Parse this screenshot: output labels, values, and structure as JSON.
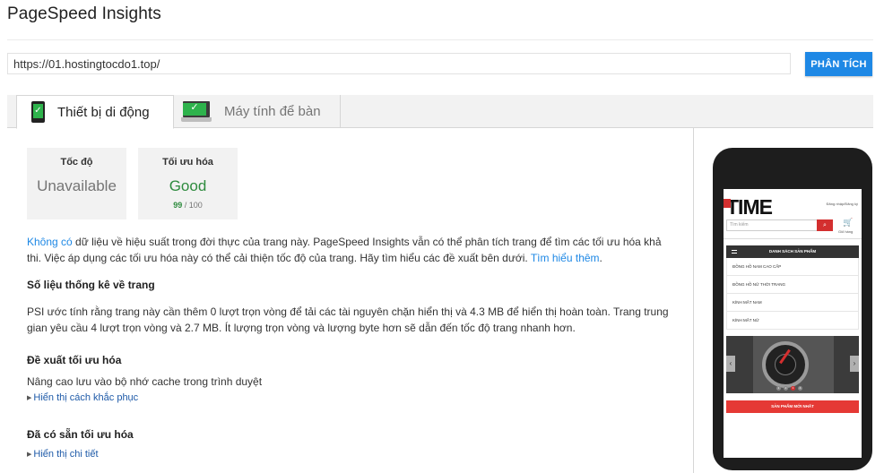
{
  "app": {
    "title": "PageSpeed Insights"
  },
  "search": {
    "url_value": "https://01.hostingtocdo1.top/",
    "analyze_label": "PHÂN TÍCH"
  },
  "tabs": [
    {
      "label": "Thiết bị di động",
      "icon": "mobile-phone-icon",
      "active": true
    },
    {
      "label": "Máy tính để bàn",
      "icon": "desktop-monitor-icon",
      "active": false
    }
  ],
  "scores": {
    "speed": {
      "label": "Tốc độ",
      "value": "Unavailable"
    },
    "optimization": {
      "label": "Tối ưu hóa",
      "value": "Good",
      "score": "99",
      "max": "/ 100"
    }
  },
  "intro": {
    "link1": "Không có",
    "text": " dữ liệu về hiệu suất trong đời thực của trang này. PageSpeed Insights vẫn có thể phân tích trang để tìm các tối ưu hóa khả thi. Việc áp dụng các tối ưu hóa này có thể cải thiện tốc độ của trang. Hãy tìm hiểu các đề xuất bên dưới. ",
    "link2": "Tìm hiểu thêm",
    "end": "."
  },
  "stats": {
    "heading": "Số liệu thống kê về trang",
    "text": "PSI ước tính rằng trang này cần thêm 0 lượt trọn vòng để tải các tài nguyên chặn hiển thị và 4.3 MB để hiển thị hoàn toàn. Trang trung gian yêu cầu 4 lượt trọn vòng và 2.7 MB. Ít lượng trọn vòng và lượng byte hơn sẽ dẫn đến tốc độ trang nhanh hơn."
  },
  "suggestions": {
    "heading": "Đề xuất tối ưu hóa",
    "item": "Nâng cao lưu vào bộ nhớ cache trong trình duyệt",
    "toggle": "Hiển thị cách khắc phục"
  },
  "existing": {
    "heading": "Đã có sẵn tối ưu hóa",
    "toggle": "Hiển thị chi tiết"
  },
  "preview": {
    "logo": "TIME",
    "login": "Đăng nhập/Đăng ký",
    "search_placeholder": "Tìm kiếm",
    "cart_label": "Giỏ hàng",
    "cart_count": "0",
    "menu_heading": "DANH SÁCH SẢN PHẨM",
    "menu_items": [
      "ĐỒNG HỒ NAM CAO CẤP",
      "ĐỒNG HỒ NỮ THỜI TRANG",
      "KÍNH MẮT NAM",
      "KÍNH MẮT NỮ"
    ],
    "slider_dots": [
      "1",
      "2",
      "3",
      "4"
    ],
    "new_products": "SẢN PHẨM MỚI NHẤT"
  },
  "colors": {
    "accent": "#1e88e5",
    "good": "#2e8b3e",
    "brand_red": "#d32f2f"
  }
}
